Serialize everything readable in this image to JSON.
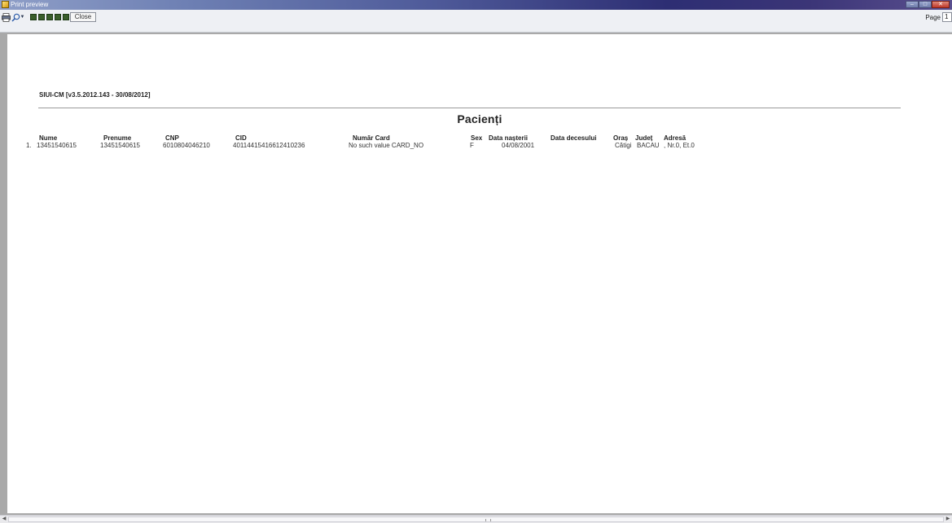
{
  "window": {
    "title": "Print preview",
    "controls": {
      "minimize": "–",
      "maximize": "□",
      "close": "✕"
    }
  },
  "toolbar": {
    "print_icon": "printer-icon",
    "zoom_icon": "magnifier-icon",
    "page_layout_buttons": [
      "one-page",
      "two-pages",
      "three-pages",
      "four-pages",
      "six-pages"
    ],
    "close_label": "Close",
    "page_label": "Page",
    "page_value": "1"
  },
  "report": {
    "header": "SIUI-CM [v3.5.2012.143 - 30/08/2012]",
    "title": "Pacienți",
    "columns": {
      "nr": "",
      "nume": "Nume",
      "prenume": "Prenume",
      "cnp": "CNP",
      "cid": "CID",
      "numar_card": "Număr Card",
      "sex": "Sex",
      "data_nasterii": "Data nașterii",
      "data_decesului": "Data decesului",
      "oras": "Oraș",
      "judet": "Județ",
      "adresa": "Adresă"
    },
    "rows": [
      {
        "nr": "1.",
        "nume": "13451540615",
        "prenume": "13451540615",
        "cnp": "6010804046210",
        "cid": "40114415416612410236",
        "numar_card": "No such value CARD_NO",
        "sex": "F",
        "data_nasterii": "04/08/2001",
        "data_decesului": "",
        "oras": "Cătigi",
        "judet": "BACAU",
        "adresa": ", Nr.0, Et.0"
      }
    ]
  },
  "colors": {
    "titlebar_start": "#8f9fc8",
    "titlebar_end": "#2d2e73",
    "toolbar_bg": "#eef0f4",
    "preview_bg": "#a9a9a9",
    "paper_bg": "#ffffff",
    "page_button": "#3a5e2b"
  }
}
